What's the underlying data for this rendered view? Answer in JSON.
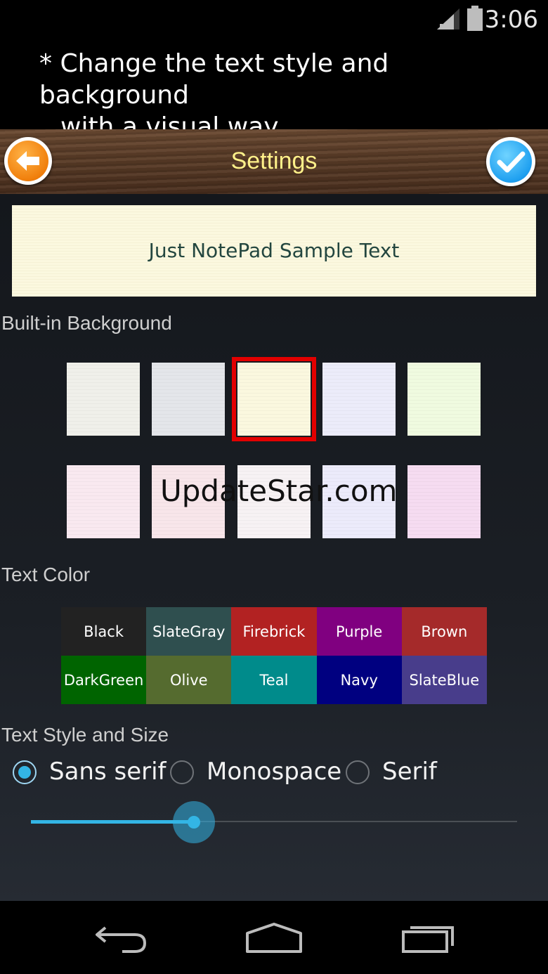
{
  "status_bar": {
    "time": "3:06"
  },
  "caption": {
    "line1": "* Change the text style and background",
    "line2": "with a visual way."
  },
  "header": {
    "title": "Settings"
  },
  "sample": {
    "text": "Just NotePad Sample Text"
  },
  "backgrounds": {
    "label": "Built-in Background",
    "selected_index": 2,
    "items": [
      {
        "name": "white-linen",
        "color": "#f0f0ea"
      },
      {
        "name": "gray-grid",
        "color": "#e4e6ea"
      },
      {
        "name": "cream-paper",
        "color": "#fbf8df"
      },
      {
        "name": "lavender-lines",
        "color": "#ececfa"
      },
      {
        "name": "mint-paper",
        "color": "#f0fbe0"
      },
      {
        "name": "pink-lines",
        "color": "#f9e9f0"
      },
      {
        "name": "pink-gingham",
        "color": "#f8e6ea"
      },
      {
        "name": "white-floral",
        "color": "#f7f2f4"
      },
      {
        "name": "purple-floral",
        "color": "#ecebfb"
      },
      {
        "name": "pink-floral",
        "color": "#f6dcf1"
      }
    ]
  },
  "watermark": "UpdateStar.com",
  "text_color": {
    "label": "Text Color",
    "colors": [
      {
        "label": "Black",
        "color": "#222222"
      },
      {
        "label": "SlateGray",
        "color": "#2f4f4f"
      },
      {
        "label": "Firebrick",
        "color": "#b22222"
      },
      {
        "label": "Purple",
        "color": "#800080"
      },
      {
        "label": "Brown",
        "color": "#a52a2a"
      },
      {
        "label": "DarkGreen",
        "color": "#006400"
      },
      {
        "label": "Olive",
        "color": "#556b2f"
      },
      {
        "label": "Teal",
        "color": "#008b8b"
      },
      {
        "label": "Navy",
        "color": "#000080"
      },
      {
        "label": "SlateBlue",
        "color": "#483d8b"
      }
    ]
  },
  "text_style": {
    "label": "Text Style and Size",
    "options": [
      {
        "label": "Sans serif",
        "checked": true
      },
      {
        "label": "Monospace",
        "checked": false
      },
      {
        "label": "Serif",
        "checked": false
      }
    ],
    "size_fraction": 0.335
  },
  "accent_color": "#33b5e5"
}
